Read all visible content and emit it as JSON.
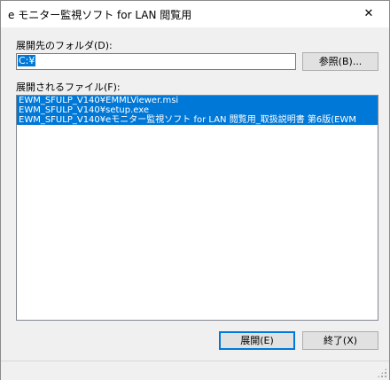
{
  "window": {
    "title": "e モニター監視ソフト for LAN 閲覧用",
    "close_glyph": "✕"
  },
  "folder": {
    "label": "展開先のフォルダ(D):",
    "value": "C:¥",
    "browse_label": "参照(B)..."
  },
  "files": {
    "label": "展開されるファイル(F):",
    "items": [
      "EWM_SFULP_V140¥EMMLViewer.msi",
      "EWM_SFULP_V140¥setup.exe",
      "EWM_SFULP_V140¥eモニター監視ソフト for LAN 閲覧用_取扱説明書 第6版(EWM"
    ]
  },
  "buttons": {
    "extract_label": "展開(E)",
    "exit_label": "終了(X)"
  },
  "colors": {
    "selection": "#0078d7",
    "window_bg": "#f0f0f0"
  }
}
